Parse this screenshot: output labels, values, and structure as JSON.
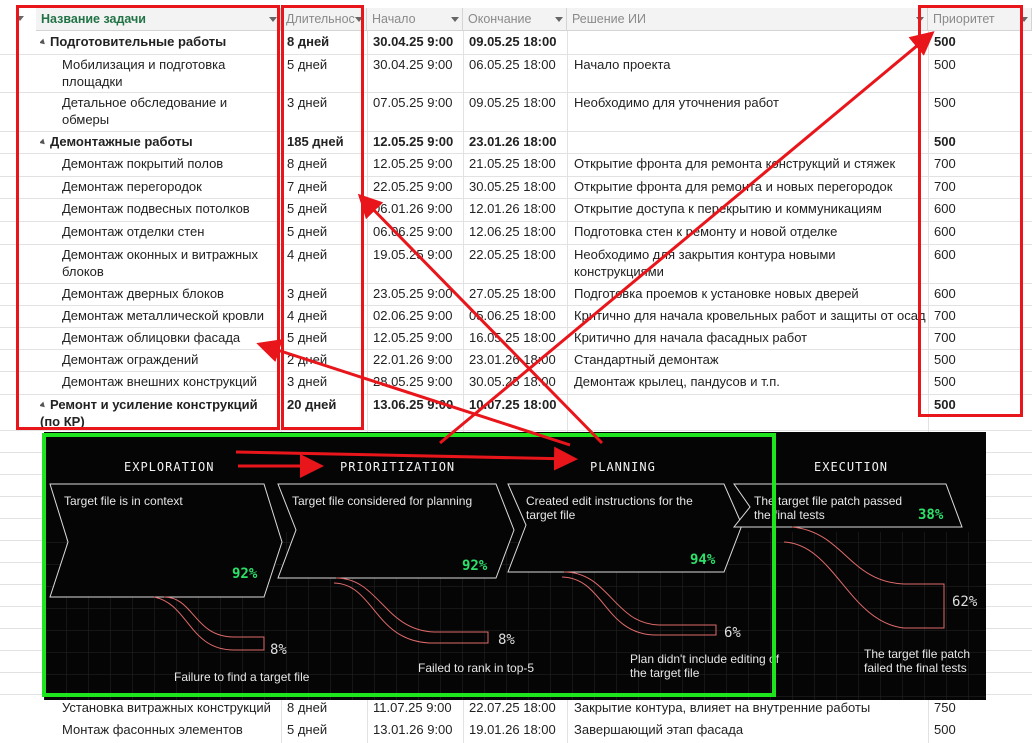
{
  "header": {
    "task_name": "Название задачи",
    "duration": "Длительнос",
    "start": "Начало",
    "finish": "Окончание",
    "ai_solution": "Решение ИИ",
    "priority": "Приоритет"
  },
  "rows": [
    {
      "name": "Подготовительные работы",
      "duration": "8 дней",
      "start": "30.04.25 9:00",
      "finish": "09.05.25 18:00",
      "solution": "",
      "priority": "500",
      "summary": true
    },
    {
      "name": "Мобилизация и подготовка площадки",
      "duration": "5 дней",
      "start": "30.04.25 9:00",
      "finish": "06.05.25 18:00",
      "solution": "Начало проекта",
      "priority": "500",
      "summary": false
    },
    {
      "name": "Детальное обследование и обмеры",
      "duration": "3 дней",
      "start": "07.05.25 9:00",
      "finish": "09.05.25 18:00",
      "solution": "Необходимо для уточнения работ",
      "priority": "500",
      "summary": false
    },
    {
      "name": "Демонтажные работы",
      "duration": "185 дней",
      "start": "12.05.25 9:00",
      "finish": "23.01.26 18:00",
      "solution": "",
      "priority": "500",
      "summary": true
    },
    {
      "name": "Демонтаж покрытий полов",
      "duration": "8 дней",
      "start": "12.05.25 9:00",
      "finish": "21.05.25 18:00",
      "solution": "Открытие фронта для ремонта конструкций и стяжек",
      "priority": "700",
      "summary": false
    },
    {
      "name": "Демонтаж перегородок",
      "duration": "7 дней",
      "start": "22.05.25 9:00",
      "finish": "30.05.25 18:00",
      "solution": "Открытие фронта для ремонта и новых перегородок",
      "priority": "700",
      "summary": false
    },
    {
      "name": "Демонтаж подвесных потолков",
      "duration": "5 дней",
      "start": "06.01.26 9:00",
      "finish": "12.01.26 18:00",
      "solution": "Открытие доступа к перекрытию и коммуникациям",
      "priority": "600",
      "summary": false
    },
    {
      "name": "Демонтаж отделки стен",
      "duration": "5 дней",
      "start": "06.06.25 9:00",
      "finish": "12.06.25 18:00",
      "solution": "Подготовка стен к ремонту и новой отделке",
      "priority": "600",
      "summary": false
    },
    {
      "name": "Демонтаж оконных и витражных блоков",
      "duration": "4 дней",
      "start": "19.05.25 9:00",
      "finish": "22.05.25 18:00",
      "solution": "Необходимо для закрытия контура новыми конструкциями",
      "priority": "600",
      "summary": false
    },
    {
      "name": "Демонтаж дверных блоков",
      "duration": "3 дней",
      "start": "23.05.25 9:00",
      "finish": "27.05.25 18:00",
      "solution": "Подготовка проемов к установке новых дверей",
      "priority": "600",
      "summary": false
    },
    {
      "name": "Демонтаж металлической кровли",
      "duration": "4 дней",
      "start": "02.06.25 9:00",
      "finish": "05.06.25 18:00",
      "solution": "Критично для начала кровельных работ и защиты от осад",
      "priority": "700",
      "summary": false
    },
    {
      "name": "Демонтаж облицовки фасада",
      "duration": "5 дней",
      "start": "12.05.25 9:00",
      "finish": "16.05.25 18:00",
      "solution": "Критично для начала фасадных работ",
      "priority": "700",
      "summary": false
    },
    {
      "name": "Демонтаж ограждений",
      "duration": "2 дней",
      "start": "22.01.26 9:00",
      "finish": "23.01.26 18:00",
      "solution": "Стандартный демонтаж",
      "priority": "500",
      "summary": false
    },
    {
      "name": "Демонтаж внешних конструкций",
      "duration": "3 дней",
      "start": "28.05.25 9:00",
      "finish": "30.05.25 18:00",
      "solution": "Демонтаж крылец, пандусов и т.п.",
      "priority": "500",
      "summary": false
    },
    {
      "name": "Ремонт и усиление конструкций (по КР)",
      "duration": "20 дней",
      "start": "13.06.25 9:00",
      "finish": "10.07.25 18:00",
      "solution": "",
      "priority": "500",
      "summary": true
    }
  ],
  "bottom_rows": [
    {
      "name": "Установка витражных конструкций",
      "duration": "8 дней",
      "start": "11.07.25 9:00",
      "finish": "22.07.25 18:00",
      "solution": "Закрытие контура, влияет на внутренние работы",
      "priority": "750"
    },
    {
      "name": "Монтаж фасонных элементов",
      "duration": "5 дней",
      "start": "13.01.26 9:00",
      "finish": "19.01.26 18:00",
      "solution": "Завершающий этап фасада",
      "priority": "500"
    }
  ],
  "funnel": {
    "stages": [
      {
        "title": "EXPLORATION",
        "success_text": "Target file is in context",
        "success_pct": "92%",
        "fail_pct": "8%",
        "fail_text": "Failure to find a target file"
      },
      {
        "title": "PRIORITIZATION",
        "success_text": "Target file considered for planning",
        "success_pct": "92%",
        "fail_pct": "8%",
        "fail_text": "Failed to rank in top-5"
      },
      {
        "title": "PLANNING",
        "success_text": "Created edit instructions for the target file",
        "success_pct": "94%",
        "fail_pct": "6%",
        "fail_text": "Plan didn't include editing of the target file"
      },
      {
        "title": "EXECUTION",
        "success_text": "The target file patch passed the final tests",
        "success_pct": "38%",
        "fail_pct": "62%",
        "fail_text": "The target file patch failed the final tests"
      }
    ]
  },
  "colors": {
    "annotation_red": "#e8151b",
    "annotation_green": "#1fe51f",
    "accent_green": "#2de06a",
    "excel_green": "#217346"
  }
}
